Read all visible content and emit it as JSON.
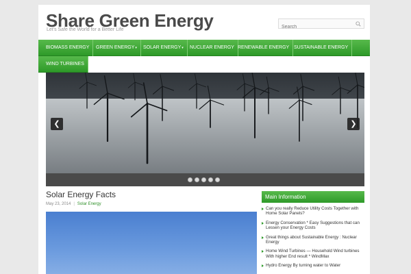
{
  "site": {
    "title": "Share Green Energy",
    "tagline": "Let's Safe the World for a Better Life"
  },
  "search": {
    "placeholder": "Search",
    "icon": "search-icon"
  },
  "nav": {
    "items": [
      {
        "label": "Biomass Energy",
        "has_submenu": false
      },
      {
        "label": "Green Energy",
        "has_submenu": true
      },
      {
        "label": "Solar Energy",
        "has_submenu": true
      },
      {
        "label": "Nuclear Energy",
        "has_submenu": false
      },
      {
        "label": "Renewable Energy",
        "has_submenu": false
      },
      {
        "label": "Sustainable Energy",
        "has_submenu": false
      },
      {
        "label": "Wind Turbines",
        "has_submenu": false
      }
    ],
    "submenu_glyph": "▾"
  },
  "slider": {
    "prev_glyph": "❮",
    "next_glyph": "❯",
    "slide_count": 5
  },
  "post": {
    "title": "Solar Energy Facts",
    "date": "May 23, 2014",
    "separator": "|",
    "category": "Solar Energy"
  },
  "sidebar": {
    "widget_title": "Main Information",
    "items": [
      "Can you really Reduce Utility Costs Together with Home Solar Panels?",
      "Energy Conservation * Easy Suggestions that can Lessen your Energy Costs",
      "Great things about Sustainable Energy : Nuclear Energy",
      "Home Wind Turbines — Household Wind turbines With higher End result * WindMax",
      "Hydro Energy By turning water to Water"
    ]
  },
  "colors": {
    "accent_green": "#2e9a29",
    "background": "#e9e9e9",
    "title_gray": "#4a4a4a"
  }
}
